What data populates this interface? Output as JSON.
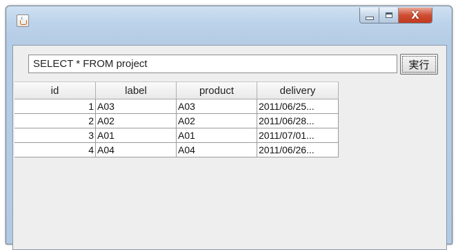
{
  "window": {
    "caption_controls": {
      "close_glyph": "X"
    }
  },
  "query": {
    "value": "SELECT * FROM project"
  },
  "run_button": {
    "label": "実行"
  },
  "table": {
    "columns": [
      "id",
      "label",
      "product",
      "delivery"
    ],
    "rows": [
      [
        "1",
        "A03",
        "A03",
        "2011/06/25..."
      ],
      [
        "2",
        "A02",
        "A02",
        "2011/06/28..."
      ],
      [
        "3",
        "A01",
        "A01",
        "2011/07/01..."
      ],
      [
        "4",
        "A04",
        "A04",
        "2011/06/26..."
      ]
    ]
  },
  "icons": {
    "app": "java-cup-icon",
    "minimize": "minimize-icon",
    "maximize": "maximize-icon",
    "close": "close-icon"
  }
}
